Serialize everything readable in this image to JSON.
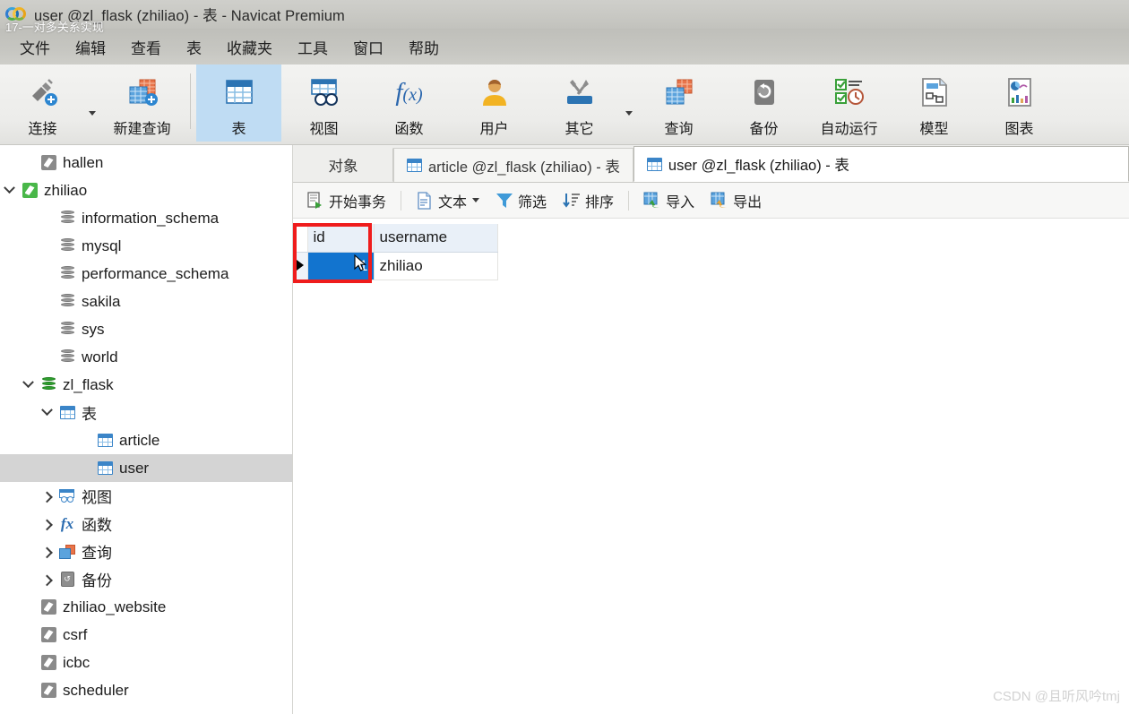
{
  "window": {
    "title": "user @zl_flask (zhiliao) - 表 - Navicat Premium",
    "overlay_caption": "17-一对多关系实现",
    "logo_icon": "navicat-logo-icon"
  },
  "menubar": {
    "items": [
      {
        "label": "文件",
        "name": "menu-file"
      },
      {
        "label": "编辑",
        "name": "menu-edit"
      },
      {
        "label": "查看",
        "name": "menu-view"
      },
      {
        "label": "表",
        "name": "menu-table"
      },
      {
        "label": "收藏夹",
        "name": "menu-favorites"
      },
      {
        "label": "工具",
        "name": "menu-tools"
      },
      {
        "label": "窗口",
        "name": "menu-window"
      },
      {
        "label": "帮助",
        "name": "menu-help"
      }
    ]
  },
  "ribbon": {
    "buttons": [
      {
        "label": "连接",
        "icon": "connection-icon",
        "active": false,
        "caret": true
      },
      {
        "label": "新建查询",
        "icon": "new-query-icon",
        "active": false,
        "caret": false
      },
      {
        "label": "表",
        "icon": "table-icon",
        "active": true,
        "caret": false
      },
      {
        "label": "视图",
        "icon": "view-icon",
        "active": false,
        "caret": false
      },
      {
        "label": "函数",
        "icon": "function-icon",
        "active": false,
        "caret": false
      },
      {
        "label": "用户",
        "icon": "user-icon",
        "active": false,
        "caret": false
      },
      {
        "label": "其它",
        "icon": "other-tools-icon",
        "active": false,
        "caret": true
      },
      {
        "label": "查询",
        "icon": "query-icon",
        "active": false,
        "caret": false
      },
      {
        "label": "备份",
        "icon": "backup-icon",
        "active": false,
        "caret": false
      },
      {
        "label": "自动运行",
        "icon": "automation-icon",
        "active": false,
        "caret": false
      },
      {
        "label": "模型",
        "icon": "model-icon",
        "active": false,
        "caret": false
      },
      {
        "label": "图表",
        "icon": "chart-icon",
        "active": false,
        "caret": false
      }
    ]
  },
  "sidebar": {
    "items": [
      {
        "label": "hallen",
        "icon": "connection-gray-icon",
        "indent": 1,
        "twisty": "none",
        "selected": false
      },
      {
        "label": "zhiliao",
        "icon": "connection-green-icon",
        "indent": 0,
        "twisty": "expanded",
        "selected": false
      },
      {
        "label": "information_schema",
        "icon": "database-gray-icon",
        "indent": 2,
        "twisty": "none",
        "selected": false
      },
      {
        "label": "mysql",
        "icon": "database-gray-icon",
        "indent": 2,
        "twisty": "none",
        "selected": false
      },
      {
        "label": "performance_schema",
        "icon": "database-gray-icon",
        "indent": 2,
        "twisty": "none",
        "selected": false
      },
      {
        "label": "sakila",
        "icon": "database-gray-icon",
        "indent": 2,
        "twisty": "none",
        "selected": false
      },
      {
        "label": "sys",
        "icon": "database-gray-icon",
        "indent": 2,
        "twisty": "none",
        "selected": false
      },
      {
        "label": "world",
        "icon": "database-gray-icon",
        "indent": 2,
        "twisty": "none",
        "selected": false
      },
      {
        "label": "zl_flask",
        "icon": "database-green-icon",
        "indent": 1,
        "twisty": "expanded",
        "selected": false
      },
      {
        "label": "表",
        "icon": "table-blue-icon",
        "indent": 2,
        "twisty": "expanded",
        "selected": false
      },
      {
        "label": "article",
        "icon": "table-blue-icon",
        "indent": 4,
        "twisty": "none",
        "selected": false
      },
      {
        "label": "user",
        "icon": "table-blue-icon",
        "indent": 4,
        "twisty": "none",
        "selected": true
      },
      {
        "label": "视图",
        "icon": "view-blue-icon",
        "indent": 2,
        "twisty": "collapsed",
        "selected": false
      },
      {
        "label": "函数",
        "icon": "function-fx-icon",
        "indent": 2,
        "twisty": "collapsed",
        "selected": false
      },
      {
        "label": "查询",
        "icon": "query-icon",
        "indent": 2,
        "twisty": "collapsed",
        "selected": false
      },
      {
        "label": "备份",
        "icon": "backup-icon",
        "indent": 2,
        "twisty": "collapsed",
        "selected": false
      },
      {
        "label": "zhiliao_website",
        "icon": "connection-gray-icon",
        "indent": 1,
        "twisty": "none",
        "selected": false
      },
      {
        "label": "csrf",
        "icon": "connection-sqlite-icon",
        "indent": 1,
        "twisty": "none",
        "selected": false
      },
      {
        "label": "icbc",
        "icon": "connection-sqlite-icon",
        "indent": 1,
        "twisty": "none",
        "selected": false
      },
      {
        "label": "scheduler",
        "icon": "connection-sqlite-icon",
        "indent": 1,
        "twisty": "none",
        "selected": false
      }
    ]
  },
  "tabs": {
    "object_tab": {
      "label": "对象",
      "name": "tab-objects"
    },
    "items": [
      {
        "label": "article @zl_flask (zhiliao) - 表",
        "name": "tab-article",
        "active": false,
        "icon": "table-blue-icon"
      },
      {
        "label": "user @zl_flask (zhiliao) - 表",
        "name": "tab-user",
        "active": true,
        "icon": "table-blue-icon"
      }
    ]
  },
  "grid_toolbar": {
    "buttons": [
      {
        "label": "开始事务",
        "icon": "begin-transaction-icon",
        "caret": false
      },
      {
        "label": "文本",
        "icon": "text-icon",
        "caret": true
      },
      {
        "label": "筛选",
        "icon": "filter-icon",
        "caret": false
      },
      {
        "label": "排序",
        "icon": "sort-icon",
        "caret": false
      },
      {
        "label": "导入",
        "icon": "import-icon",
        "caret": false
      },
      {
        "label": "导出",
        "icon": "export-icon",
        "caret": false
      }
    ]
  },
  "grid": {
    "columns": [
      "id",
      "username"
    ],
    "rows": [
      {
        "id": "1",
        "username": "zhiliao",
        "current": true,
        "selected_column": "id"
      }
    ]
  },
  "annotation": {
    "highlight_color": "#ef1c1c",
    "cursor_icon": "mouse-pointer-icon"
  },
  "watermark": {
    "text": "CSDN @且听风吟tmj"
  },
  "colors": {
    "accent": "#1274cf",
    "ribbon_active": "#bfdcf3",
    "selection": "#d4d4d4"
  }
}
